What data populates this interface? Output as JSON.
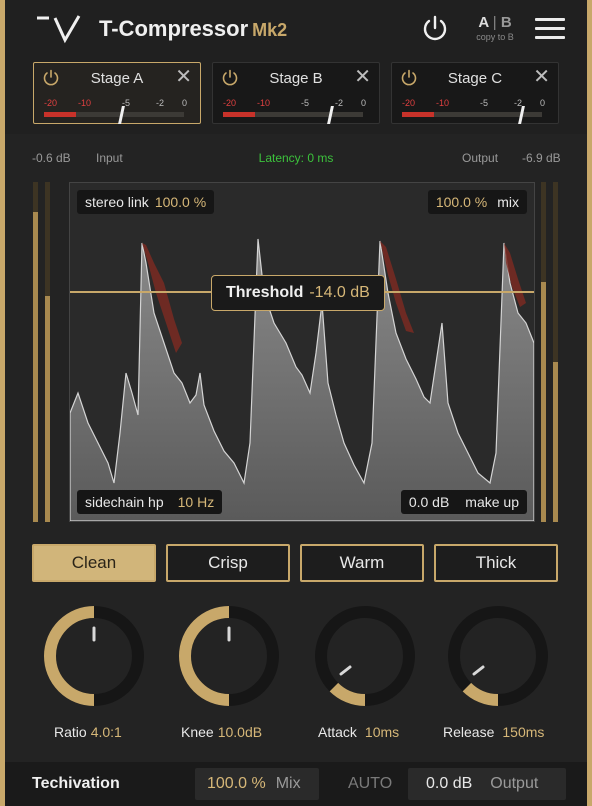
{
  "header": {
    "title": "T-Compressor",
    "title_suffix": "Mk2",
    "ab_a": "A",
    "ab_b": "B",
    "ab_copy": "copy to B"
  },
  "stages": [
    {
      "name": "Stage A",
      "active": true,
      "ticks": [
        "-20",
        "-10",
        "-5",
        "-2",
        "0"
      ]
    },
    {
      "name": "Stage B",
      "active": false,
      "ticks": [
        "-20",
        "-10",
        "-5",
        "-2",
        "0"
      ]
    },
    {
      "name": "Stage C",
      "active": false,
      "ticks": [
        "-20",
        "-10",
        "-5",
        "-2",
        "0"
      ]
    }
  ],
  "io": {
    "input_value": "-0.6 dB",
    "input_label": "Input",
    "latency": "Latency: 0 ms",
    "output_label": "Output",
    "output_value": "-6.9 dB"
  },
  "graph": {
    "stereo_link_label": "stereo link",
    "stereo_link_value": "100.0 %",
    "mix_value": "100.0 %",
    "mix_label": "mix",
    "threshold_label": "Threshold",
    "threshold_value": "-14.0 dB",
    "sidechain_label": "sidechain hp",
    "sidechain_value": "10 Hz",
    "makeup_value": "0.0 dB",
    "makeup_label": "make up"
  },
  "presets": [
    {
      "label": "Clean",
      "selected": true
    },
    {
      "label": "Crisp",
      "selected": false
    },
    {
      "label": "Warm",
      "selected": false
    },
    {
      "label": "Thick",
      "selected": false
    }
  ],
  "knobs": [
    {
      "label": "Ratio",
      "value": "4.0:1",
      "level": 0.5
    },
    {
      "label": "Knee",
      "value": "10.0dB",
      "level": 0.5
    },
    {
      "label": "Attack",
      "value": "10ms",
      "level": 0.2
    },
    {
      "label": "Release",
      "value": "150ms",
      "level": 0.2
    }
  ],
  "footer": {
    "brand": "Techivation",
    "mix_value": "100.0 %",
    "mix_label": "Mix",
    "auto_label": "AUTO",
    "output_value": "0.0 dB",
    "output_label": "Output"
  },
  "colors": {
    "accent": "#c8a86a",
    "latency_green": "#3cc23c",
    "reduction_red": "#c8322a"
  }
}
